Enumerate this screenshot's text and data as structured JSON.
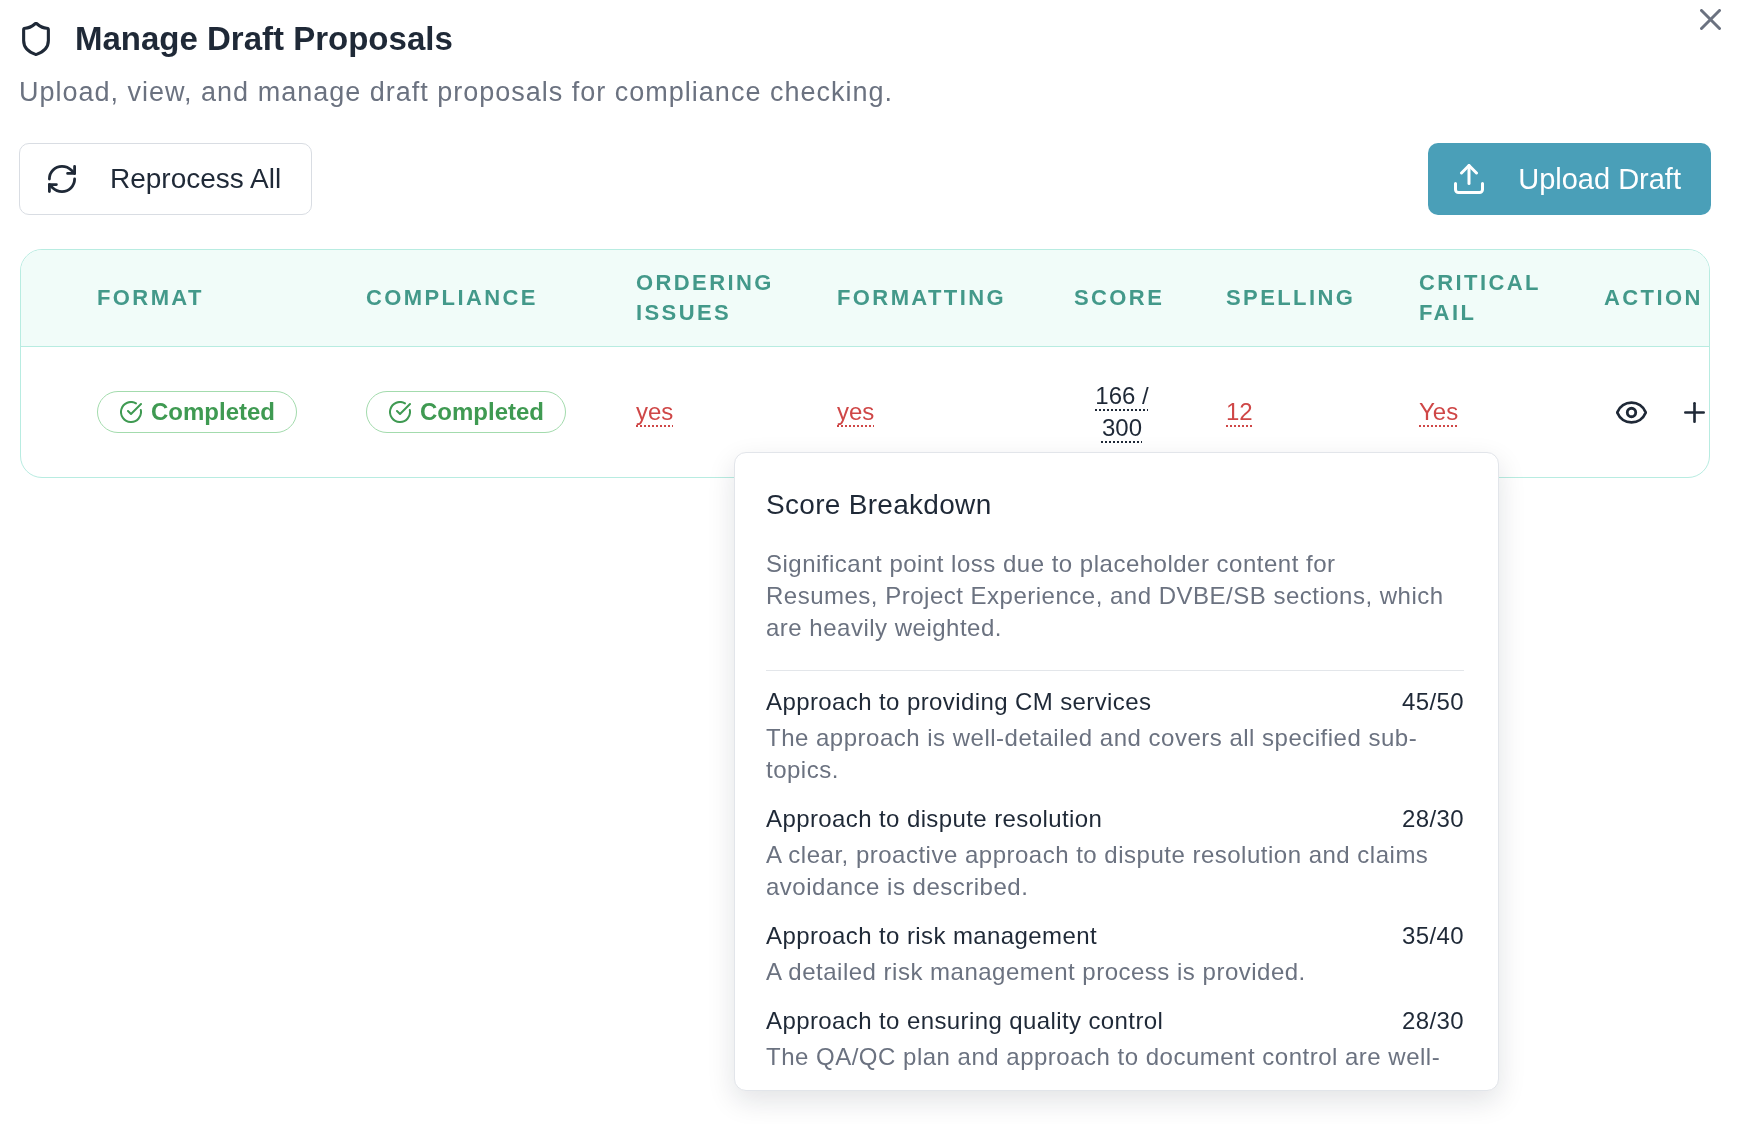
{
  "dialog": {
    "title": "Manage Draft Proposals",
    "subtitle": "Upload, view, and manage draft proposals for compliance checking."
  },
  "toolbar": {
    "buttons": [
      {
        "label": "Reprocess All",
        "kind": "secondary"
      },
      {
        "label": "Upload Draft",
        "kind": "primary"
      }
    ]
  },
  "table": {
    "columns": [
      "FORMAT",
      "COMPLIANCE",
      "ORDERING ISSUES",
      "FORMATTING",
      "SCORE",
      "SPELLING",
      "CRITICAL FAIL",
      "ACTION"
    ],
    "rows": [
      {
        "cells": [
          {
            "kind": "status",
            "text": "Completed"
          },
          {
            "kind": "status",
            "text": "Completed"
          },
          {
            "kind": "flag",
            "text": "yes"
          },
          {
            "kind": "flag",
            "text": "yes"
          },
          {
            "kind": "score",
            "text": "166 / 300"
          },
          {
            "kind": "flag",
            "text": "12"
          },
          {
            "kind": "flag",
            "text": "Yes"
          },
          {
            "kind": "actions"
          }
        ]
      }
    ]
  },
  "score_breakdown": {
    "title": "Score Breakdown",
    "summary": "Significant point loss due to placeholder content for Resumes, Project Experience, and DVBE/SB sections, which are heavily weighted.",
    "criteria": [
      {
        "name": "Approach to providing CM services",
        "score": "45/50",
        "comment": "The approach is well-detailed and covers all specified sub-topics."
      },
      {
        "name": "Approach to dispute resolution",
        "score": "28/30",
        "comment": "A clear, proactive approach to dispute resolution and claims avoidance is described."
      },
      {
        "name": "Approach to risk management",
        "score": "35/40",
        "comment": "A detailed risk management process is provided."
      },
      {
        "name": "Approach to ensuring quality control",
        "score": "28/30",
        "comment": "The QA/QC plan and approach to document control are well-"
      }
    ]
  }
}
